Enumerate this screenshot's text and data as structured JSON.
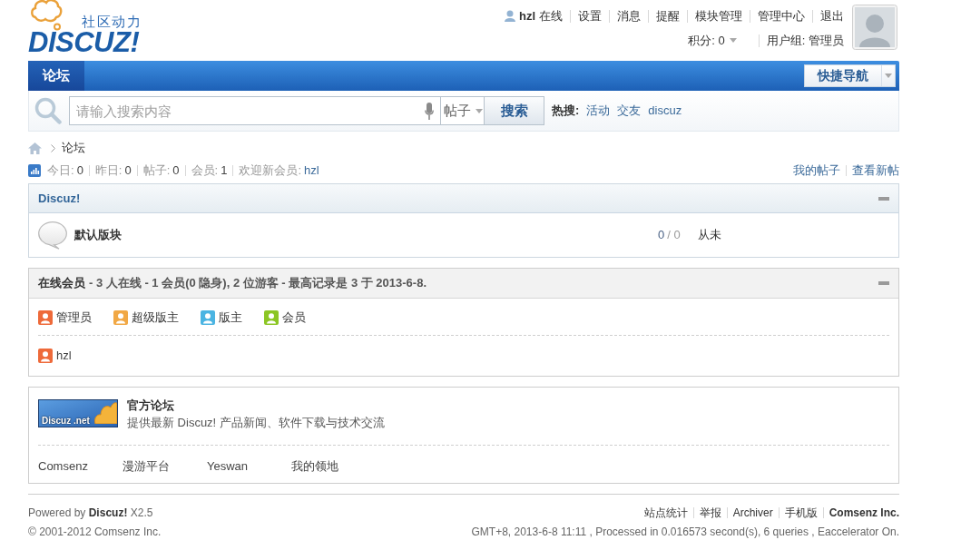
{
  "header": {
    "logo": {
      "tagline": "社区动力",
      "name": "DISCUZ!"
    },
    "user": {
      "name": "hzl",
      "status": "在线"
    },
    "user_links": [
      "设置",
      "消息",
      "提醒",
      "模块管理",
      "管理中心",
      "退出"
    ],
    "credits": "积分: 0",
    "group": "用户组: 管理员"
  },
  "nav": {
    "tabs": [
      {
        "label": "论坛",
        "selected": true
      }
    ],
    "quick_nav": "快捷导航"
  },
  "search": {
    "placeholder": "请输入搜索内容",
    "type": "帖子",
    "button": "搜索",
    "hot_label": "热搜:",
    "hot": [
      "活动",
      "交友",
      "discuz"
    ]
  },
  "breadcrumb": [
    "论坛"
  ],
  "stats": {
    "items": [
      {
        "kind": "count",
        "label": "今日:",
        "value": "0"
      },
      {
        "kind": "count",
        "label": "昨日:",
        "value": "0"
      },
      {
        "kind": "count",
        "label": "帖子:",
        "value": "0"
      },
      {
        "kind": "count",
        "label": "会员:",
        "value": "1"
      },
      {
        "kind": "member",
        "label": "欢迎新会员:",
        "value": "hzl"
      }
    ],
    "links": [
      "我的帖子",
      "查看新帖"
    ]
  },
  "forum_category": {
    "title": "Discuz!",
    "expanded": true,
    "forums": [
      {
        "name": "默认版块",
        "threads": "0",
        "posts": "/ 0",
        "last_post": "从未"
      }
    ]
  },
  "online": {
    "title": "在线会员",
    "summary": "- 3 人在线 - 1 会员(0 隐身), 2 位游客 - 最高记录是 3 于 2013-6-8.",
    "expanded": true,
    "legend": [
      {
        "label": "管理员",
        "color": "#ee6a3a"
      },
      {
        "label": "超级版主",
        "color": "#f1a845"
      },
      {
        "label": "版主",
        "color": "#4bb4e2"
      },
      {
        "label": "会员",
        "color": "#8cc624"
      }
    ],
    "members": [
      {
        "name": "hzl",
        "color": "#ee6a3a"
      }
    ]
  },
  "friend_links": {
    "featured": {
      "banner": "Discuz .net",
      "title": "官方论坛",
      "description": "提供最新 Discuz! 产品新闻、软件下载与技术交流"
    },
    "links": [
      "Comsenz",
      "漫游平台",
      "Yeswan",
      "我的领地"
    ]
  },
  "footer": {
    "powered": "Powered by **Discuz!** X2.5",
    "copyright": "© 2001-2012 Comsenz Inc.",
    "links": [
      {
        "label": "站点统计",
        "bold": false
      },
      {
        "label": "举报",
        "bold": false
      },
      {
        "label": "Archiver",
        "bold": false
      },
      {
        "label": "手机版",
        "bold": false
      },
      {
        "label": "Comsenz Inc.",
        "bold": true
      }
    ],
    "info": "GMT+8, 2013-6-8 11:11 , Processed in 0.016573 second(s), 6 queries , Eaccelerator On."
  }
}
